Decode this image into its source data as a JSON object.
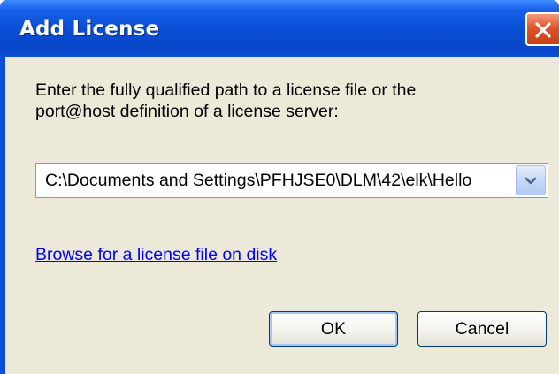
{
  "window": {
    "title": "Add License",
    "close_icon": "close-icon"
  },
  "dialog": {
    "prompt": "Enter the fully qualified path to a license file or the\nport@host definition of a license server:",
    "path_combo": {
      "value": "C:\\Documents and Settings\\PFHJSE0\\DLM\\42\\elk\\Hello",
      "dropdown_icon": "chevron-down-icon"
    },
    "browse_link": "Browse for a license file on disk",
    "ok_label": "OK",
    "cancel_label": "Cancel"
  },
  "colors": {
    "titlebar": "#0a4fd6",
    "client_background": "#ece9d8",
    "close_button": "#e0542d",
    "link": "#0000ff"
  }
}
